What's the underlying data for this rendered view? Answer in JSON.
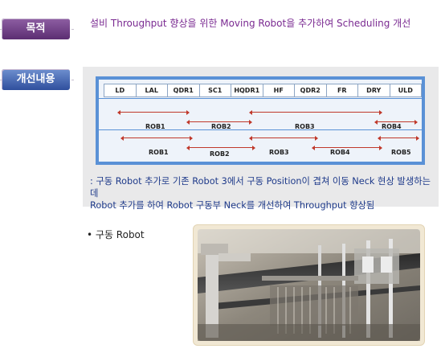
{
  "purpose_section": {
    "tag": "목적",
    "text": "설비 Throughput 향상을 위한 Moving Robot을 추가하여 Scheduling 개선"
  },
  "improve_section": {
    "tag": "개선내용",
    "diagram": {
      "stations": [
        "LD",
        "LAL",
        "QDR1",
        "SC1",
        "HQDR1",
        "HF",
        "QDR2",
        "FR",
        "DRY",
        "ULD"
      ],
      "before_robots": [
        "ROB1",
        "ROB2",
        "ROB3",
        "ROB4"
      ],
      "after_robots": [
        "ROB1",
        "ROB2",
        "ROB3",
        "ROB4",
        "ROB5"
      ]
    },
    "note_line1": ": 구동 Robot 추가로 기존 Robot 3에서 구동 Position이 겹쳐 이동 Neck 현상 발생하는데",
    "note_line2": "Robot  추가를 하여 Robot 구동부 Neck를 개선하여 Throughput 향상됨"
  },
  "photo_section": {
    "bullet": "•",
    "label": "구동  Robot"
  }
}
